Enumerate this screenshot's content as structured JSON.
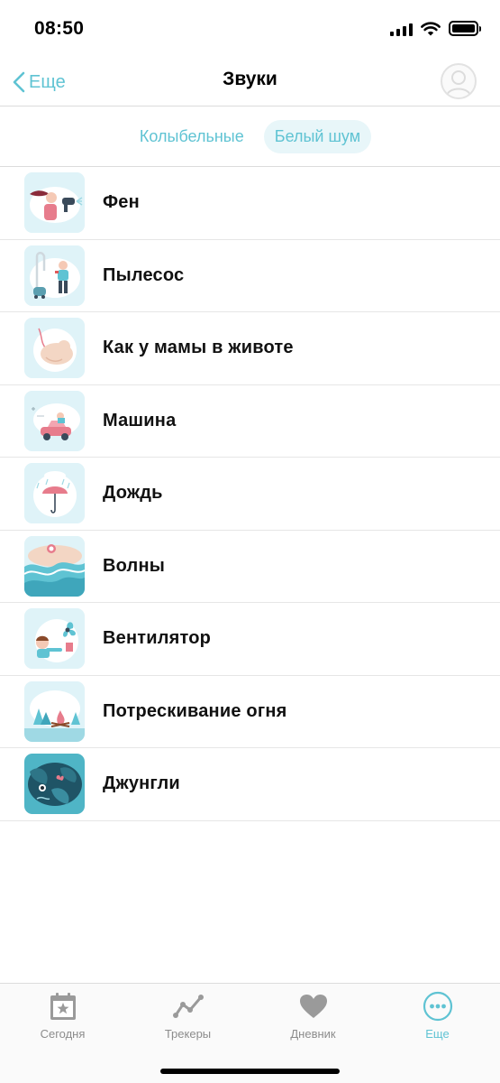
{
  "status": {
    "time": "08:50"
  },
  "nav": {
    "back_label": "Еще",
    "title": "Звуки"
  },
  "segments": [
    {
      "label": "Колыбельные",
      "active": false
    },
    {
      "label": "Белый шум",
      "active": true
    }
  ],
  "sounds": [
    {
      "label": "Фен",
      "icon": "hair-dryer-icon"
    },
    {
      "label": "Пылесос",
      "icon": "vacuum-cleaner-icon"
    },
    {
      "label": "Как у мамы в животе",
      "icon": "womb-icon"
    },
    {
      "label": "Машина",
      "icon": "car-icon"
    },
    {
      "label": "Дождь",
      "icon": "rain-icon"
    },
    {
      "label": "Волны",
      "icon": "waves-icon"
    },
    {
      "label": "Вентилятор",
      "icon": "fan-icon"
    },
    {
      "label": "Потрескивание огня",
      "icon": "campfire-icon"
    },
    {
      "label": "Джунгли",
      "icon": "jungle-icon"
    }
  ],
  "tabs": [
    {
      "label": "Сегодня",
      "icon": "calendar-star-icon",
      "active": false
    },
    {
      "label": "Трекеры",
      "icon": "trend-line-icon",
      "active": false
    },
    {
      "label": "Дневник",
      "icon": "heart-icon",
      "active": false
    },
    {
      "label": "Еще",
      "icon": "more-icon",
      "active": true
    }
  ],
  "colors": {
    "accent": "#5fc3d3",
    "inactive": "#8c8c8c",
    "segment_active_bg": "#e8f6f9"
  }
}
